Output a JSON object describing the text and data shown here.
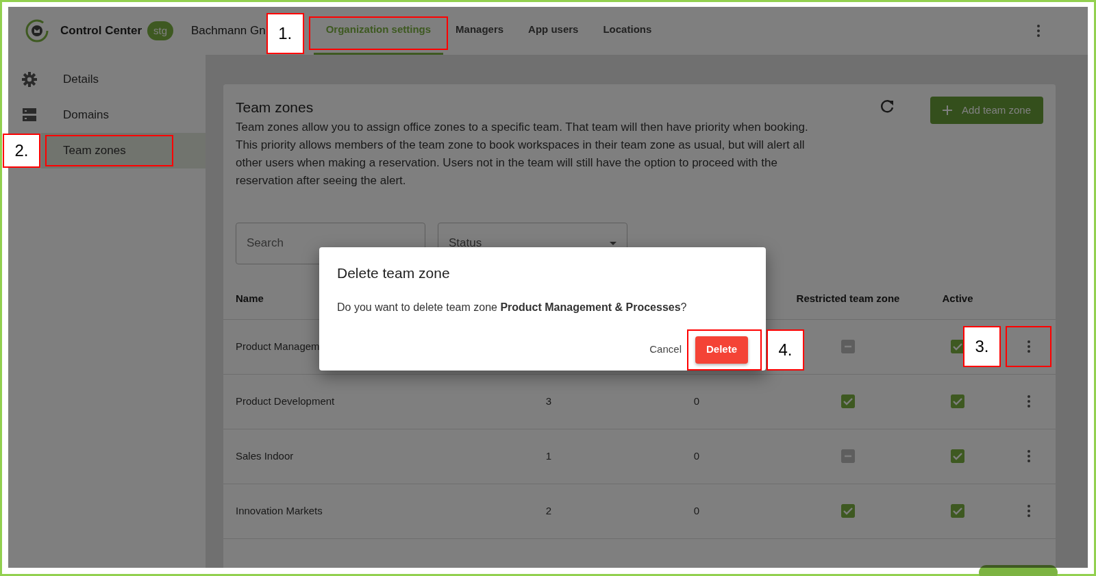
{
  "app": {
    "title": "Control Center",
    "badge": "stg",
    "organization": "Bachmann Gn"
  },
  "tabs": [
    {
      "label": "Organization settings",
      "selected": true,
      "callout": "1."
    },
    {
      "label": "Managers",
      "selected": false
    },
    {
      "label": "App users",
      "selected": false
    },
    {
      "label": "Locations",
      "selected": false
    }
  ],
  "sidebar": {
    "items": [
      {
        "label": "Details",
        "selected": false
      },
      {
        "label": "Domains",
        "selected": false
      },
      {
        "label": "Team zones",
        "selected": true,
        "callout": "2."
      }
    ]
  },
  "page": {
    "title": "Team zones",
    "description": "Team zones allow you to assign office zones to a specific team. That team will then have priority when booking. This priority allows members of the team zone to book workspaces in their team zone as usual, but will alert all other users when making a reservation. Users not in the team will still have the option to proceed with the reservation after seeing the alert.",
    "add_button": "Add team zone"
  },
  "filters": {
    "search": {
      "placeholder": "Search"
    },
    "status": {
      "placeholder": "Status"
    }
  },
  "table": {
    "columns": {
      "name": "Name",
      "restricted": "Restricted team zone",
      "active": "Active"
    },
    "rows": [
      {
        "name": "Product Managem",
        "restricted": false,
        "active": true,
        "menu_callout": "3."
      },
      {
        "name": "Product Development",
        "column_2": "3",
        "column_3": "0",
        "restricted": true,
        "active": true
      },
      {
        "name": "Sales Indoor",
        "column_2": "1",
        "column_3": "0",
        "restricted": false,
        "active": true
      },
      {
        "name": "Innovation Markets",
        "column_2": "2",
        "column_3": "0",
        "restricted": true,
        "active": true
      }
    ]
  },
  "dialog": {
    "title": "Delete team zone",
    "message": "Do you want to delete team zone **Product Management & Processes**?",
    "buttons": [
      {
        "label": "Cancel",
        "kind": "text"
      },
      {
        "label": "Delete",
        "kind": "danger",
        "callout": "4."
      }
    ]
  }
}
